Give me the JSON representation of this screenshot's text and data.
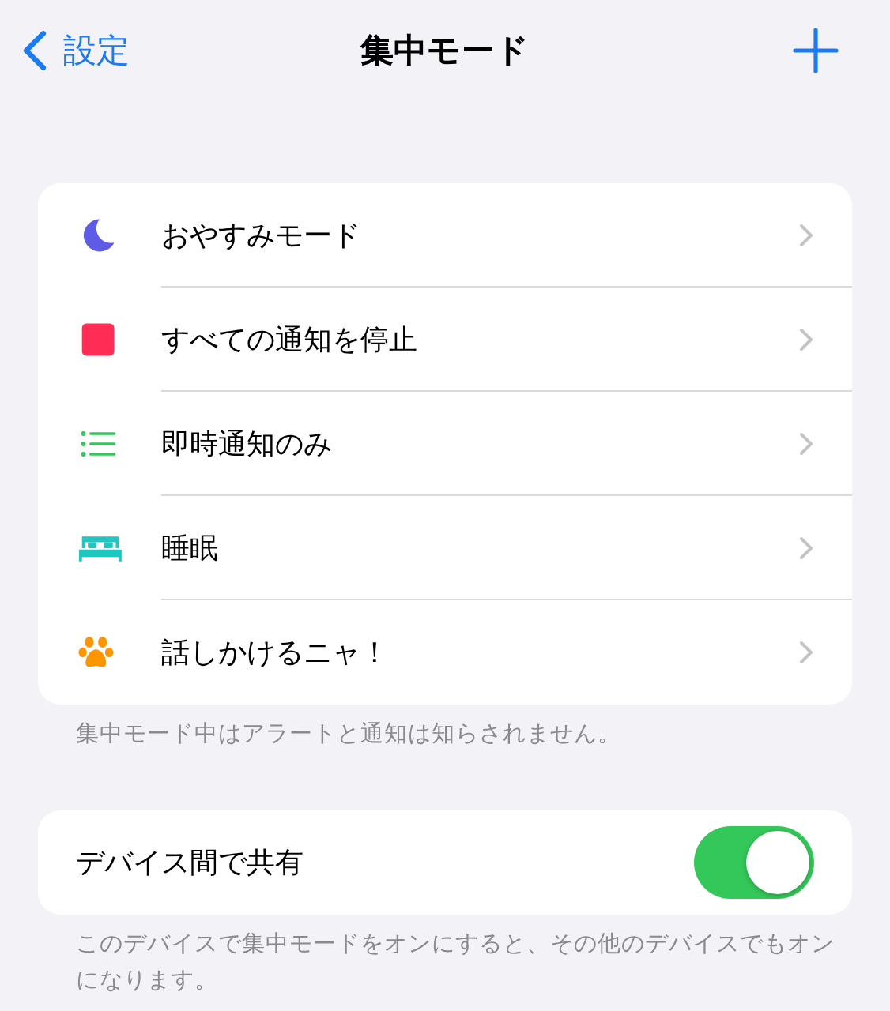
{
  "nav": {
    "back_label": "設定",
    "title": "集中モード"
  },
  "focus_modes": [
    {
      "kind": "moon",
      "color": "#5e5ce6",
      "label": "おやすみモード"
    },
    {
      "kind": "square",
      "color": "#ff2d55",
      "label": "すべての通知を停止"
    },
    {
      "kind": "list",
      "color": "#34c759",
      "label": "即時通知のみ"
    },
    {
      "kind": "bed",
      "color": "#1ec8c0",
      "label": "睡眠"
    },
    {
      "kind": "paw",
      "color": "#ff9500",
      "label": "話しかけるニャ！"
    }
  ],
  "focus_footer": "集中モード中はアラートと通知は知らされません。",
  "share": {
    "label": "デバイス間で共有",
    "on": true
  },
  "share_footer": "このデバイスで集中モードをオンにすると、その他のデバイスでもオンになります。"
}
